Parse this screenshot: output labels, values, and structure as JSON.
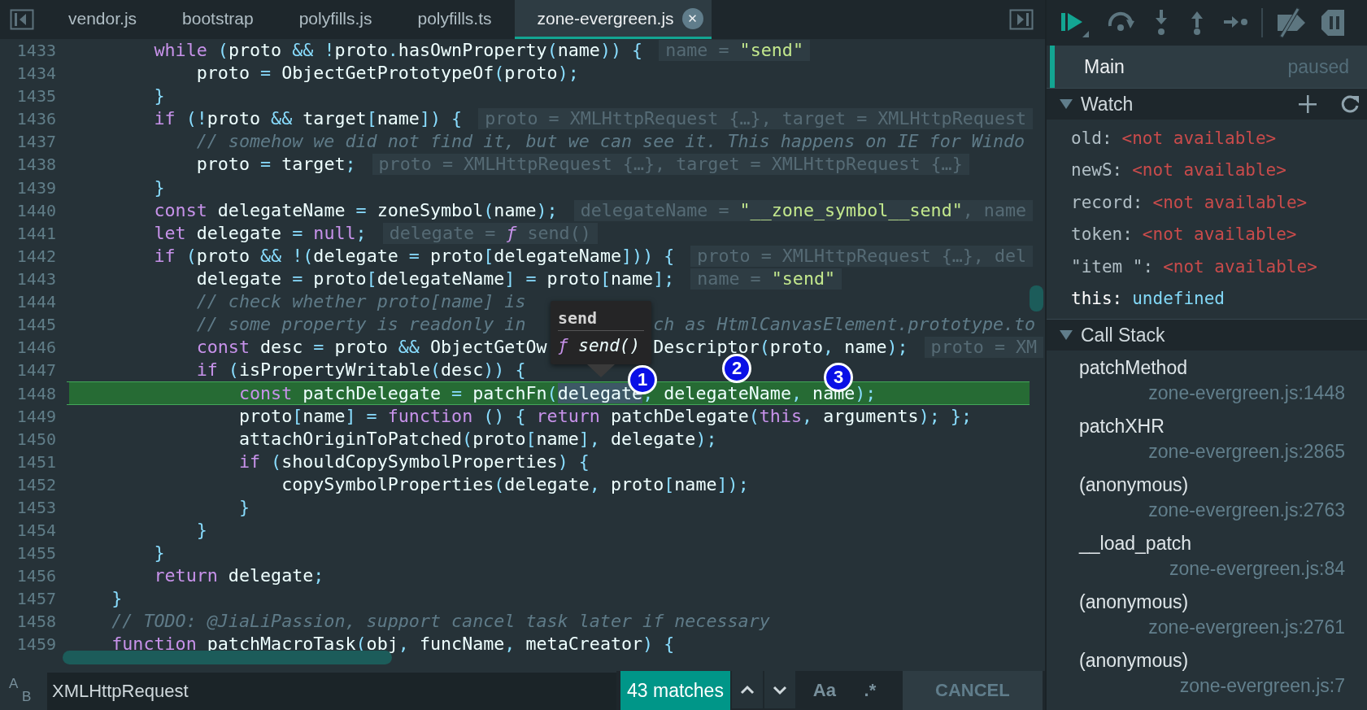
{
  "tabs": [
    {
      "label": "vendor.js",
      "selected": false
    },
    {
      "label": "bootstrap",
      "selected": false
    },
    {
      "label": "polyfills.js",
      "selected": false
    },
    {
      "label": "polyfills.ts",
      "selected": false
    },
    {
      "label": "zone-evergreen.js",
      "selected": true,
      "close": "✕"
    }
  ],
  "editor": {
    "lines": [
      {
        "number": "1433",
        "current": false,
        "segments": [
          [
            {
              "kind": "kw",
              "text": "        while"
            },
            {
              "kind": "p",
              "text": " ("
            },
            {
              "kind": "id",
              "text": "proto"
            },
            {
              "kind": "p",
              "text": " &&"
            },
            {
              "kind": "p",
              "text": " !"
            },
            {
              "kind": "id",
              "text": "proto"
            },
            {
              "kind": "p",
              "text": "."
            },
            {
              "kind": "id",
              "text": "hasOwnProperty"
            },
            {
              "kind": "p",
              "text": "("
            },
            {
              "kind": "id",
              "text": "name"
            },
            {
              "kind": "p",
              "text": "))"
            },
            {
              "kind": "p",
              "text": " {"
            }
          ]
        ],
        "hint": [
          {
            "kind": "h",
            "text": "name = "
          },
          {
            "kind": "s",
            "text": "\"send\""
          }
        ]
      },
      {
        "number": "1434",
        "current": false,
        "segments": [
          [
            {
              "kind": "id",
              "text": "            proto"
            },
            {
              "kind": "p",
              "text": " ="
            },
            {
              "kind": "id",
              "text": " ObjectGetPrototypeOf"
            },
            {
              "kind": "p",
              "text": "("
            },
            {
              "kind": "id",
              "text": "proto"
            },
            {
              "kind": "p",
              "text": ");"
            }
          ]
        ]
      },
      {
        "number": "1435",
        "current": false,
        "segments": [
          [
            {
              "kind": "p",
              "text": "        }"
            }
          ]
        ]
      },
      {
        "number": "1436",
        "current": false,
        "segments": [
          [
            {
              "kind": "kw",
              "text": "        if"
            },
            {
              "kind": "p",
              "text": " (!"
            },
            {
              "kind": "id",
              "text": "proto"
            },
            {
              "kind": "p",
              "text": " &&"
            },
            {
              "kind": "id",
              "text": " target"
            },
            {
              "kind": "p",
              "text": "["
            },
            {
              "kind": "id",
              "text": "name"
            },
            {
              "kind": "p",
              "text": "])"
            },
            {
              "kind": "p",
              "text": " {"
            }
          ]
        ],
        "hint": [
          {
            "kind": "h",
            "text": "proto = XMLHttpRequest {…}, target = XMLHttpRequest"
          }
        ]
      },
      {
        "number": "1437",
        "current": false,
        "segments": [
          [
            {
              "kind": "c",
              "text": "            // somehow we did not find it, but we can see it. This happens on IE for Windo"
            }
          ]
        ]
      },
      {
        "number": "1438",
        "current": false,
        "segments": [
          [
            {
              "kind": "id",
              "text": "            proto"
            },
            {
              "kind": "p",
              "text": " ="
            },
            {
              "kind": "id",
              "text": " target"
            },
            {
              "kind": "p",
              "text": ";"
            }
          ]
        ],
        "hint": [
          {
            "kind": "h",
            "text": "proto = XMLHttpRequest {…}, target = XMLHttpRequest {…}"
          }
        ]
      },
      {
        "number": "1439",
        "current": false,
        "segments": [
          [
            {
              "kind": "p",
              "text": "        }"
            }
          ]
        ]
      },
      {
        "number": "1440",
        "current": false,
        "segments": [
          [
            {
              "kind": "kw",
              "text": "        const"
            },
            {
              "kind": "id",
              "text": " delegateName"
            },
            {
              "kind": "p",
              "text": " ="
            },
            {
              "kind": "id",
              "text": " zoneSymbol"
            },
            {
              "kind": "p",
              "text": "("
            },
            {
              "kind": "id",
              "text": "name"
            },
            {
              "kind": "p",
              "text": ");"
            }
          ]
        ],
        "hint": [
          {
            "kind": "h",
            "text": "delegateName = "
          },
          {
            "kind": "s",
            "text": "\"__zone_symbol__send\""
          },
          {
            "kind": "h",
            "text": ", name"
          }
        ]
      },
      {
        "number": "1441",
        "current": false,
        "segments": [
          [
            {
              "kind": "kw",
              "text": "        let"
            },
            {
              "kind": "id",
              "text": " delegate"
            },
            {
              "kind": "p",
              "text": " ="
            },
            {
              "kind": "kw",
              "text": " null"
            },
            {
              "kind": "p",
              "text": ";"
            }
          ]
        ],
        "hint": [
          {
            "kind": "h",
            "text": "delegate = "
          },
          {
            "kind": "fn",
            "text": "ƒ"
          },
          {
            "kind": "h",
            "text": " send()"
          }
        ]
      },
      {
        "number": "1442",
        "current": false,
        "segments": [
          [
            {
              "kind": "kw",
              "text": "        if"
            },
            {
              "kind": "p",
              "text": " ("
            },
            {
              "kind": "id",
              "text": "proto"
            },
            {
              "kind": "p",
              "text": " &&"
            },
            {
              "kind": "p",
              "text": " !("
            },
            {
              "kind": "id",
              "text": "delegate"
            },
            {
              "kind": "p",
              "text": " ="
            },
            {
              "kind": "id",
              "text": " proto"
            },
            {
              "kind": "p",
              "text": "["
            },
            {
              "kind": "id",
              "text": "delegateName"
            },
            {
              "kind": "p",
              "text": "]))"
            },
            {
              "kind": "p",
              "text": " {"
            }
          ]
        ],
        "hint": [
          {
            "kind": "h",
            "text": "proto = XMLHttpRequest {…}, del"
          }
        ]
      },
      {
        "number": "1443",
        "current": false,
        "segments": [
          [
            {
              "kind": "id",
              "text": "            delegate"
            },
            {
              "kind": "p",
              "text": " ="
            },
            {
              "kind": "id",
              "text": " proto"
            },
            {
              "kind": "p",
              "text": "["
            },
            {
              "kind": "id",
              "text": "delegateName"
            },
            {
              "kind": "p",
              "text": "]"
            },
            {
              "kind": "p",
              "text": " ="
            },
            {
              "kind": "id",
              "text": " proto"
            },
            {
              "kind": "p",
              "text": "["
            },
            {
              "kind": "id",
              "text": "name"
            },
            {
              "kind": "p",
              "text": "];"
            }
          ]
        ],
        "hint": [
          {
            "kind": "h",
            "text": "name = "
          },
          {
            "kind": "s",
            "text": "\"send\""
          }
        ]
      },
      {
        "number": "1444",
        "current": false,
        "segments": [
          [
            {
              "kind": "c",
              "text": "            // check whether proto[name] is"
            }
          ]
        ]
      },
      {
        "number": "1445",
        "current": false,
        "segments": [
          [
            {
              "kind": "c",
              "text": "            // some property is readonly in"
            }
          ],
          [
            {
              "kind": "c",
              "text": "ch as HtmlCanvasElement.prototype.to"
            }
          ]
        ]
      },
      {
        "number": "1446",
        "current": false,
        "segments": [
          [
            {
              "kind": "kw",
              "text": "            const"
            },
            {
              "kind": "id",
              "text": " desc"
            },
            {
              "kind": "p",
              "text": " ="
            },
            {
              "kind": "id",
              "text": " proto"
            },
            {
              "kind": "p",
              "text": " &&"
            },
            {
              "kind": "id",
              "text": " ObjectGetOw"
            }
          ],
          [
            {
              "kind": "id",
              "text": "Descriptor"
            },
            {
              "kind": "p",
              "text": "("
            },
            {
              "kind": "id",
              "text": "proto"
            },
            {
              "kind": "p",
              "text": ","
            },
            {
              "kind": "id",
              "text": " name"
            },
            {
              "kind": "p",
              "text": ");"
            }
          ]
        ],
        "hint": [
          {
            "kind": "h",
            "text": "proto = XM"
          }
        ]
      },
      {
        "number": "1447",
        "current": false,
        "segments": [
          [
            {
              "kind": "kw",
              "text": "            if"
            },
            {
              "kind": "p",
              "text": " ("
            },
            {
              "kind": "id",
              "text": "isPropertyWritable"
            },
            {
              "kind": "p",
              "text": "("
            },
            {
              "kind": "id",
              "text": "desc"
            },
            {
              "kind": "p",
              "text": "))"
            },
            {
              "kind": "p",
              "text": " {"
            }
          ]
        ]
      },
      {
        "number": "1448",
        "current": true,
        "segments": [
          [
            {
              "kind": "kw",
              "text": "                const"
            },
            {
              "kind": "id",
              "text": " patchDelegate"
            },
            {
              "kind": "p",
              "text": " ="
            },
            {
              "kind": "id",
              "text": " patchFn"
            },
            {
              "kind": "p",
              "text": "("
            },
            {
              "kind": "sel",
              "text": "delegate"
            },
            {
              "kind": "p",
              "text": ","
            },
            {
              "kind": "id",
              "text": " delegateName"
            },
            {
              "kind": "p",
              "text": ","
            },
            {
              "kind": "id",
              "text": " name"
            },
            {
              "kind": "p",
              "text": ");"
            }
          ]
        ]
      },
      {
        "number": "1449",
        "current": false,
        "segments": [
          [
            {
              "kind": "id",
              "text": "                proto"
            },
            {
              "kind": "p",
              "text": "["
            },
            {
              "kind": "id",
              "text": "name"
            },
            {
              "kind": "p",
              "text": "]"
            },
            {
              "kind": "p",
              "text": " ="
            },
            {
              "kind": "kw",
              "text": " function"
            },
            {
              "kind": "p",
              "text": " ()"
            },
            {
              "kind": "p",
              "text": " {"
            },
            {
              "kind": "kw",
              "text": " return"
            },
            {
              "kind": "id",
              "text": " patchDelegate"
            },
            {
              "kind": "p",
              "text": "("
            },
            {
              "kind": "kw",
              "text": "this"
            },
            {
              "kind": "p",
              "text": ","
            },
            {
              "kind": "id",
              "text": " arguments"
            },
            {
              "kind": "p",
              "text": ");"
            },
            {
              "kind": "p",
              "text": " };"
            }
          ]
        ]
      },
      {
        "number": "1450",
        "current": false,
        "segments": [
          [
            {
              "kind": "id",
              "text": "                attachOriginToPatched"
            },
            {
              "kind": "p",
              "text": "("
            },
            {
              "kind": "id",
              "text": "proto"
            },
            {
              "kind": "p",
              "text": "["
            },
            {
              "kind": "id",
              "text": "name"
            },
            {
              "kind": "p",
              "text": "],"
            },
            {
              "kind": "id",
              "text": " delegate"
            },
            {
              "kind": "p",
              "text": ");"
            }
          ]
        ]
      },
      {
        "number": "1451",
        "current": false,
        "segments": [
          [
            {
              "kind": "kw",
              "text": "                if"
            },
            {
              "kind": "p",
              "text": " ("
            },
            {
              "kind": "id",
              "text": "shouldCopySymbolProperties"
            },
            {
              "kind": "p",
              "text": ")"
            },
            {
              "kind": "p",
              "text": " {"
            }
          ]
        ]
      },
      {
        "number": "1452",
        "current": false,
        "segments": [
          [
            {
              "kind": "id",
              "text": "                    copySymbolProperties"
            },
            {
              "kind": "p",
              "text": "("
            },
            {
              "kind": "id",
              "text": "delegate"
            },
            {
              "kind": "p",
              "text": ","
            },
            {
              "kind": "id",
              "text": " proto"
            },
            {
              "kind": "p",
              "text": "["
            },
            {
              "kind": "id",
              "text": "name"
            },
            {
              "kind": "p",
              "text": "]);"
            }
          ]
        ]
      },
      {
        "number": "1453",
        "current": false,
        "segments": [
          [
            {
              "kind": "p",
              "text": "                }"
            }
          ]
        ]
      },
      {
        "number": "1454",
        "current": false,
        "segments": [
          [
            {
              "kind": "p",
              "text": "            }"
            }
          ]
        ]
      },
      {
        "number": "1455",
        "current": false,
        "segments": [
          [
            {
              "kind": "p",
              "text": "        }"
            }
          ]
        ]
      },
      {
        "number": "1456",
        "current": false,
        "segments": [
          [
            {
              "kind": "kw",
              "text": "        return"
            },
            {
              "kind": "id",
              "text": " delegate"
            },
            {
              "kind": "p",
              "text": ";"
            }
          ]
        ]
      },
      {
        "number": "1457",
        "current": false,
        "segments": [
          [
            {
              "kind": "p",
              "text": "    }"
            }
          ]
        ]
      },
      {
        "number": "1458",
        "current": false,
        "segments": [
          [
            {
              "kind": "c",
              "text": "    // TODO: @JiaLiPassion, support cancel task later if necessary"
            }
          ]
        ]
      },
      {
        "number": "1459",
        "current": false,
        "segments": [
          [
            {
              "kind": "kw",
              "text": "    function"
            },
            {
              "kind": "id",
              "text": " patchMacroTask"
            },
            {
              "kind": "p",
              "text": "("
            },
            {
              "kind": "id",
              "text": "obj"
            },
            {
              "kind": "p",
              "text": ","
            },
            {
              "kind": "id",
              "text": " funcName"
            },
            {
              "kind": "p",
              "text": ","
            },
            {
              "kind": "id",
              "text": " metaCreator"
            },
            {
              "kind": "p",
              "text": ")"
            },
            {
              "kind": "p",
              "text": " {"
            }
          ]
        ]
      }
    ],
    "tooltip": {
      "title": "send",
      "value": [
        {
          "kind": "fn",
          "text": "ƒ"
        },
        {
          "kind": "v",
          "text": " send()"
        }
      ]
    },
    "markers": [
      "1",
      "2",
      "3"
    ]
  },
  "search": {
    "replace_toggle": [
      "A",
      "B"
    ],
    "value": "XMLHttpRequest",
    "matches": "43 matches",
    "case_label": "Aa",
    "regex_label": ".*",
    "cancel": "CANCEL"
  },
  "debugger": {
    "thread": {
      "name": "Main",
      "status": "paused"
    },
    "watch": {
      "title": "Watch",
      "expanded": true,
      "items": [
        {
          "name": "old:",
          "value": "<not available>",
          "kind": "error"
        },
        {
          "name": "newS:",
          "value": "<not available>",
          "kind": "error"
        },
        {
          "name": "record:",
          "value": "<not available>",
          "kind": "error"
        },
        {
          "name": "token:",
          "value": "<not available>",
          "kind": "error"
        },
        {
          "name": "\"item \":",
          "value": "<not available>",
          "kind": "error"
        },
        {
          "name": "this:",
          "value": "undefined",
          "kind": "value"
        }
      ]
    },
    "call_stack": {
      "title": "Call Stack",
      "expanded": true,
      "frames": [
        {
          "name": "patchMethod",
          "location": "zone-evergreen.js:1448"
        },
        {
          "name": "patchXHR",
          "location": "zone-evergreen.js:2865"
        },
        {
          "name": "(anonymous)",
          "location": "zone-evergreen.js:2763"
        },
        {
          "name": "__load_patch",
          "location": "zone-evergreen.js:84"
        },
        {
          "name": "(anonymous)",
          "location": "zone-evergreen.js:2761"
        },
        {
          "name": "(anonymous)",
          "location": "zone-evergreen.js:7"
        }
      ]
    }
  }
}
